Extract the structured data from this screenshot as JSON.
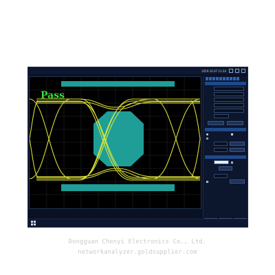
{
  "app": {
    "menu": [
      "",
      "",
      "",
      "",
      "",
      "",
      "",
      "",
      "",
      ""
    ],
    "clock": "2019.10.07 11:34"
  },
  "scope": {
    "pass_label": "Pass",
    "waveform_title": "",
    "y_labels": [
      "",
      "",
      "",
      "",
      "",
      "",
      "",
      "",
      "",
      "",
      ""
    ],
    "footer_left": "",
    "footer_right": "",
    "colors": {
      "eye": "#e6ea3a",
      "mask": "#1f9e97",
      "grid": "#2a2a2a"
    }
  },
  "panel": {
    "header1": "",
    "rows": [
      {
        "label": "",
        "value": ""
      },
      {
        "label": "",
        "value": ""
      },
      {
        "label": "",
        "value": ""
      },
      {
        "label": "",
        "value": ""
      },
      {
        "label": "",
        "value": ""
      },
      {
        "label": "",
        "value": ""
      }
    ],
    "buttons_a": [
      "",
      ""
    ],
    "header2": "",
    "opt1": "",
    "opt2": "",
    "chk1": "",
    "row_scale": {
      "label": "",
      "value": ""
    },
    "row_ref": {
      "label": "",
      "value": ""
    },
    "btn_set": "",
    "btn_set2": "",
    "header3": "",
    "row_trig": {
      "label": "",
      "value": ""
    },
    "chk2": "",
    "btn_mid": "",
    "row_last": {
      "label": "",
      "value": ""
    },
    "chk3": "",
    "btn_last": ""
  },
  "bottom_tabs": [
    "",
    "",
    ""
  ],
  "statusbar": {
    "left": "",
    "right": ""
  },
  "watermark": {
    "line1": "Dongguan Chenyi Electronics Co., Ltd.",
    "line2": "networkanalyzer.goldsupplier.com"
  }
}
